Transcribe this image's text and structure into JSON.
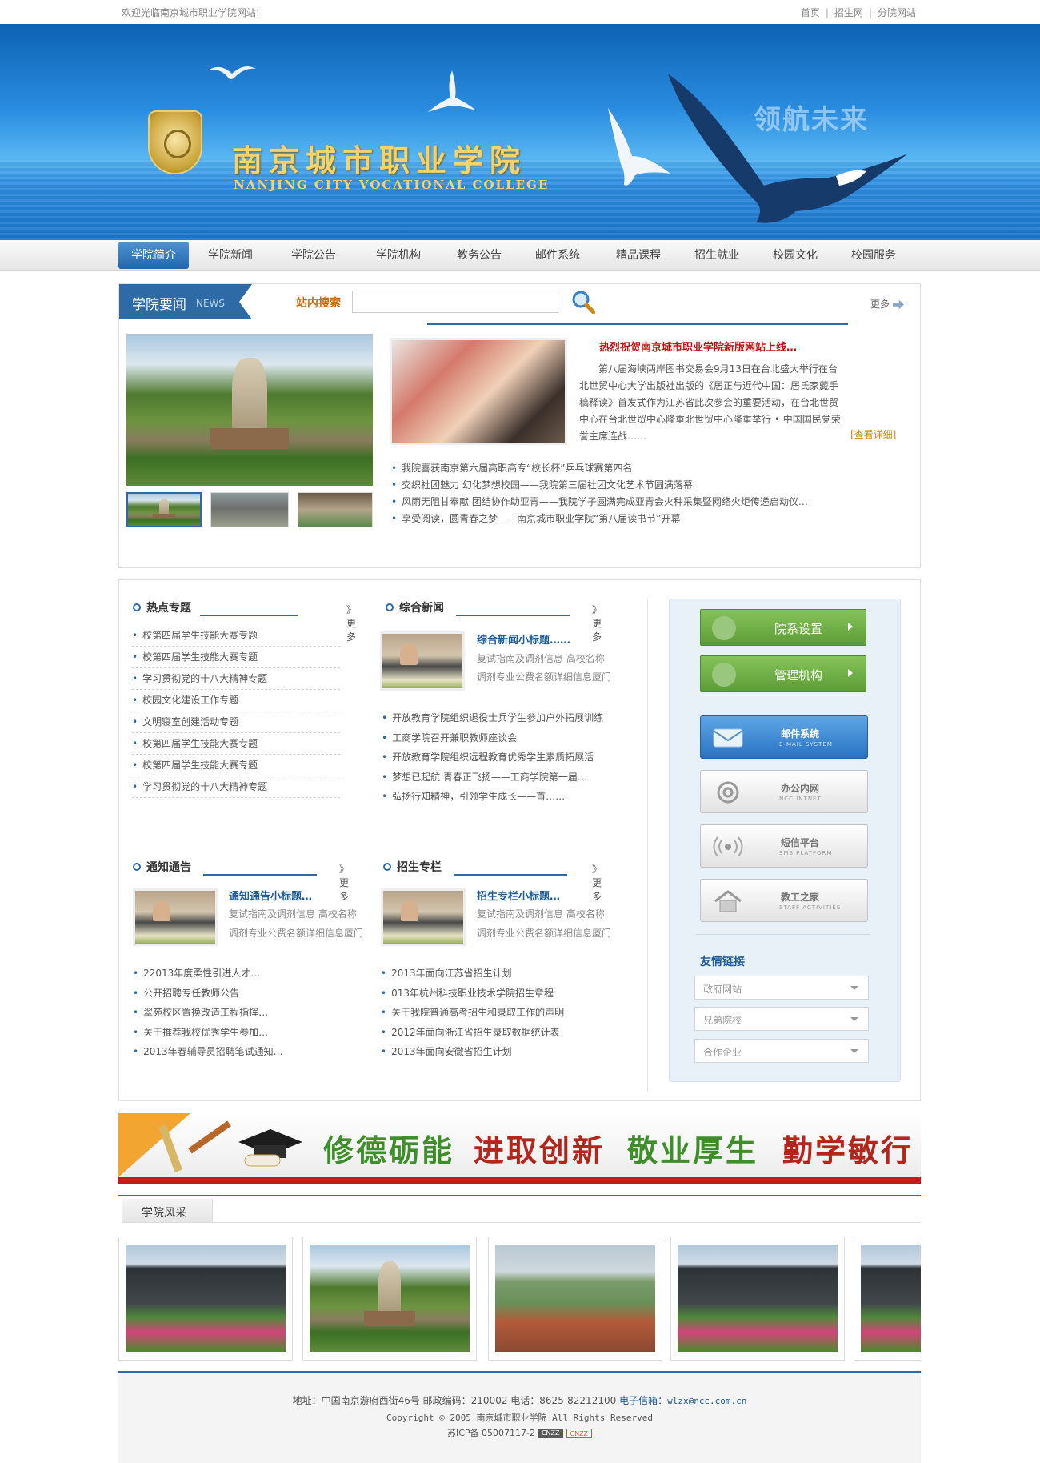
{
  "topbar": {
    "welcome": "欢迎光临南京城市职业学院网站!",
    "links": [
      "首页",
      "招生网",
      "分院网站"
    ]
  },
  "banner": {
    "cn_name": "南京城市职业学院",
    "en_name": "NANJING CITY VOCATIONAL COLLEGE",
    "slogan": "领航未来"
  },
  "nav": {
    "items": [
      "学院简介",
      "学院新闻",
      "学院公告",
      "学院机构",
      "教务公告",
      "邮件系统",
      "精品课程",
      "招生就业",
      "校园文化",
      "校园服务"
    ],
    "active": "学院简介"
  },
  "news": {
    "title": "学院要闻",
    "title_en": "NEWS",
    "search_label": "站内搜索",
    "search_value": "",
    "more": "更多",
    "headline": "热烈祝贺南京城市职业学院新版网站上线…",
    "headline_text": "第八届海峡两岸图书交易会9月13日在台北盛大举行在台北世贸中心大学出版社出版的《居正与近代中国：居氏家藏手稿释读》首发式作为江苏省此次参会的重要活动，在台北世贸中心在台北世贸中心隆重北世贸中心隆重举行 • 中国国民党荣誉主席连战……",
    "view_detail": "[查看详细]",
    "items": [
      "我院喜获南京第六届高职高专“校长杯”乒乓球赛第四名",
      "交织社团魅力 幻化梦想校园——我院第三届社团文化艺术节圆满落幕",
      "风雨无阻甘奉献 团结协作助亚青——我院学子圆满完成亚青会火种采集暨网络火炬传递启动仪…",
      "享受阅读，圆青春之梦——南京城市职业学院“第八届读书节”开幕"
    ]
  },
  "topics": {
    "title": "热点专题",
    "more": "》更多",
    "items": [
      "校第四届学生技能大赛专题",
      "校第四届学生技能大赛专题",
      "学习贯彻党的十八大精神专题",
      "校园文化建设工作专题",
      "文明寝室创建活动专题",
      "校第四届学生技能大赛专题",
      "校第四届学生技能大赛专题",
      "学习贯彻党的十八大精神专题"
    ]
  },
  "general_news": {
    "title": "综合新闻",
    "more": "》更多",
    "feature_title": "综合新闻小标题……",
    "feature_lines": [
      "复试指南及调剂信息  高校名称",
      "调剂专业公费名额详细信息厦门"
    ],
    "items": [
      "开放教育学院组织退役士兵学生参加户外拓展训练",
      "工商学院召开兼职教师座谈会",
      "开放教育学院组织远程教育优秀学生素质拓展活",
      "梦想已起航 青春正飞扬——工商学院第一届…",
      "弘扬行知精神，引领学生成长——首……"
    ]
  },
  "notices": {
    "title": "通知通告",
    "more": "》更多",
    "feature_title": "通知通告小标题…",
    "feature_lines": [
      "复试指南及调剂信息  高校名称",
      "调剂专业公费名额详细信息厦门"
    ],
    "items": [
      "22013年度柔性引进人才…",
      "公开招聘专任教师公告",
      "翠苑校区置换改造工程指挥…",
      "关于推荐我校优秀学生参加…",
      "2013年春辅导员招聘笔试通知…"
    ]
  },
  "admissions": {
    "title": "招生专栏",
    "more": "》更多",
    "feature_title": "招生专栏小标题…",
    "feature_lines": [
      "复试指南及调剂信息  高校名称",
      "调剂专业公费名额详细信息厦门"
    ],
    "items": [
      "2013年面向江苏省招生计划",
      "013年杭州科技职业技术学院招生章程",
      "关于我院普通高考招生和录取工作的声明",
      "2012年面向浙江省招生录取数据统计表",
      "2013年面向安徽省招生计划"
    ]
  },
  "sidebar": {
    "buttons": [
      {
        "label": "院系设置"
      },
      {
        "label": "管理机构"
      }
    ],
    "services": [
      {
        "label": "邮件系统",
        "sub": "E-MAIL SYSTEM"
      },
      {
        "label": "办公内网",
        "sub": "NCC  INTNET"
      },
      {
        "label": "短信平台",
        "sub": "SMS PLATFORM"
      },
      {
        "label": "教工之家",
        "sub": "STAFF ACTIVITIES"
      }
    ],
    "links_title": "友情链接",
    "link_selects": [
      "政府网站",
      "兄弟院校",
      "合作企业"
    ]
  },
  "motto": [
    "修德砺能",
    "进取创新",
    "敬业厚生",
    "勤学敏行"
  ],
  "gallery": {
    "title": "学院风采"
  },
  "footer": {
    "line1_prefix": "地址：中国南京游府西街46号 邮政编码：210002 电话：8625-82212100",
    "email_label": "电子信箱：",
    "email": "wlzx@ncc.com.cn",
    "copyright": "Copyright © 2005 南京城市职业学院 All Rights Reserved",
    "icp": "苏ICP备 05007117-2",
    "badges": [
      "CNZZ",
      "CNZZ"
    ]
  },
  "colors": {
    "primary": "#2d6aa6",
    "accent_red": "#c01010",
    "accent_orange": "#c96a0a",
    "green": "#5e9d36"
  }
}
